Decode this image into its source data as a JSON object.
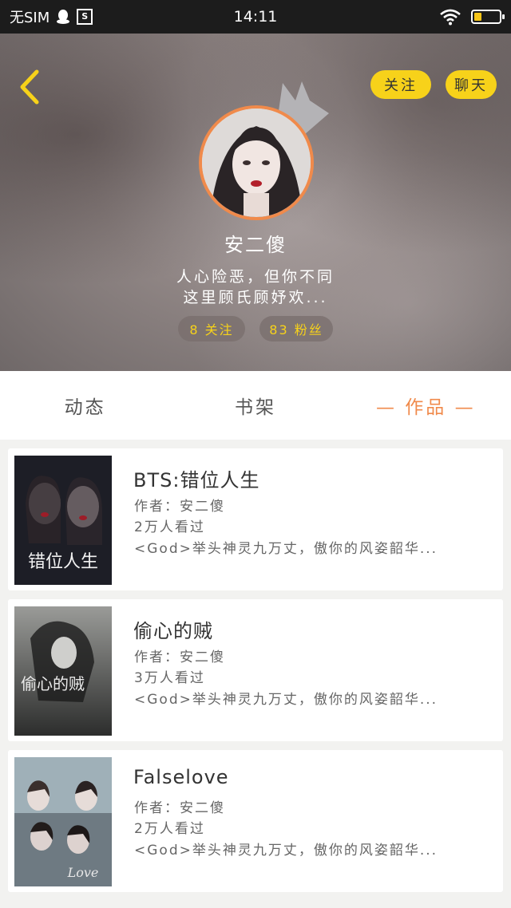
{
  "status_bar": {
    "carrier": "无SIM",
    "time": "14:11",
    "s_icon": "S",
    "battery_level": 0.3
  },
  "header": {
    "follow_label": "关注",
    "chat_label": "聊天",
    "name": "安二傻",
    "bio_line1": "人心险恶，但你不同",
    "bio_line2": "这里顾氏顾妤欢...",
    "following": "8 关注",
    "followers": "83 粉丝",
    "accent_color": "#f7d21a"
  },
  "tabs": [
    {
      "label": "动态"
    },
    {
      "label": "书架"
    },
    {
      "label": "— 作品 —",
      "active": true
    }
  ],
  "works": [
    {
      "title": "BTS:错位人生",
      "author": "作者：安二傻",
      "views": "2万人看过",
      "summary": "<God>举头神灵九万丈，傲你的风姿韶华...",
      "cover_text": "错位人生"
    },
    {
      "title": "偷心的贼",
      "author": "作者：安二傻",
      "views": "3万人看过",
      "summary": "<God>举头神灵九万丈，傲你的风姿韶华...",
      "cover_text": "偷心的贼"
    },
    {
      "title": "Falselove",
      "author": "作者：安二傻",
      "views": "2万人看过",
      "summary": "<God>举头神灵九万丈，傲你的风姿韶华...",
      "cover_text": "Love"
    }
  ]
}
